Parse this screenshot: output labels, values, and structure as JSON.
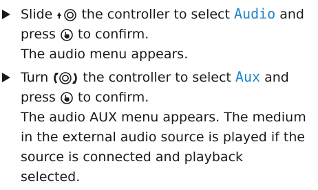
{
  "steps": [
    {
      "action_prefix": "Slide",
      "action_middle": "the controller to select",
      "menu_item": "Audio",
      "action_suffix": "and",
      "confirm_prefix": "press",
      "confirm_suffix": "to confirm.",
      "controller_icon": "slide-up-controller-icon",
      "confirm_icon": "press-controller-icon",
      "result_lines": [
        "The audio menu appears."
      ]
    },
    {
      "action_prefix": "Turn",
      "action_middle": "the controller to select",
      "menu_item": "Aux",
      "action_suffix": "and",
      "confirm_prefix": "press",
      "confirm_suffix": "to confirm.",
      "controller_icon": "turn-controller-icon",
      "confirm_icon": "press-controller-icon",
      "result_lines": [
        "The audio AUX menu appears. The medium",
        "in the external audio source is played if the",
        "source is connected and playback",
        "selected."
      ]
    }
  ],
  "colors": {
    "text": "#1a1a1a",
    "ui_term": "#1f86c8"
  }
}
